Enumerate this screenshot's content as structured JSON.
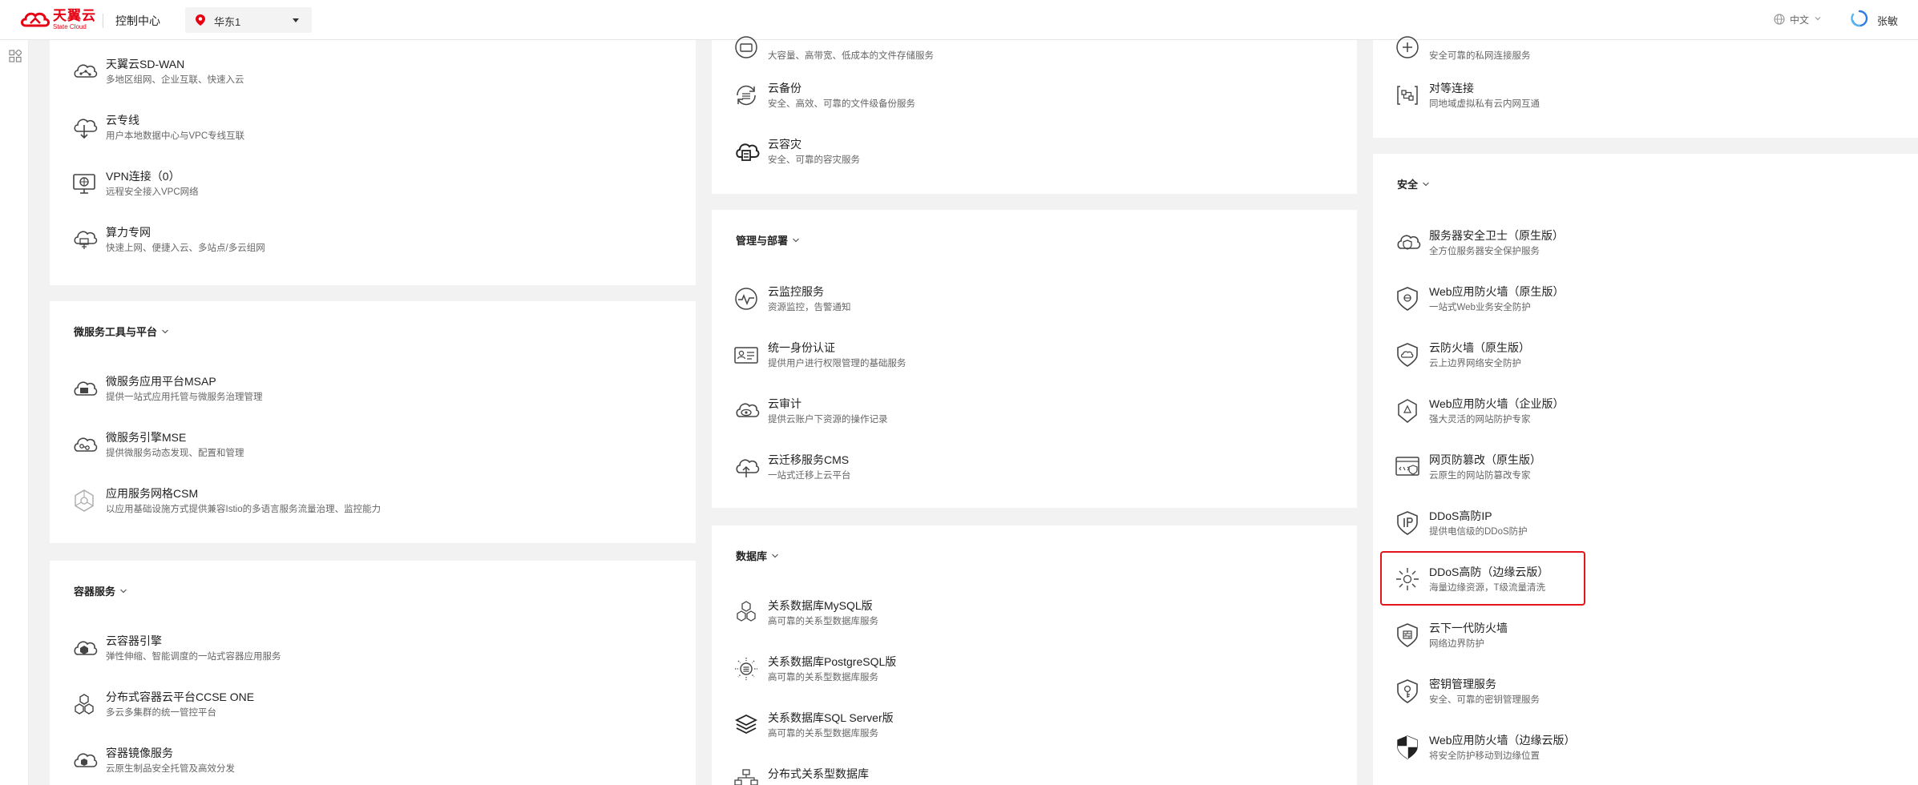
{
  "header": {
    "logo_text": "天翼云",
    "logo_sub": "State Cloud",
    "console_title": "控制中心",
    "region": "华东1",
    "lang": "中文",
    "user": "张敏"
  },
  "colors": {
    "brand": "#e60012",
    "highlight": "#e3161b"
  },
  "col_a": {
    "network_items": [
      {
        "name": "天翼云SD-WAN",
        "desc": "多地区组网、企业互联、快速入云",
        "icon": "sdwan-icon"
      },
      {
        "name": "云专线",
        "desc": "用户本地数据中心与VPC专线互联",
        "icon": "dedicated-line-icon"
      },
      {
        "name": "VPN连接（0）",
        "desc": "远程安全接入VPC网络",
        "icon": "vpn-icon"
      },
      {
        "name": "算力专网",
        "desc": "快速上网、便捷入云、多站点/多云组网",
        "icon": "computing-network-icon"
      }
    ],
    "micro_title": "微服务工具与平台",
    "micro_items": [
      {
        "name": "微服务应用平台MSAP",
        "desc": "提供一站式应用托管与微服务治理管理",
        "icon": "msap-icon"
      },
      {
        "name": "微服务引擎MSE",
        "desc": "提供微服务动态发现、配置和管理",
        "icon": "mse-icon"
      },
      {
        "name": "应用服务网格CSM",
        "desc": "以应用基础设施方式提供兼容Istio的多语言服务流量治理、监控能力",
        "icon": "csm-icon"
      }
    ],
    "container_title": "容器服务",
    "container_items": [
      {
        "name": "云容器引擎",
        "desc": "弹性伸缩、智能调度的一站式容器应用服务",
        "icon": "container-engine-icon"
      },
      {
        "name": "分布式容器云平台CCSE ONE",
        "desc": "多云多集群的统一管控平台",
        "icon": "ccse-one-icon"
      },
      {
        "name": "容器镜像服务",
        "desc": "云原生制品安全托管及高效分发",
        "icon": "image-registry-icon"
      }
    ]
  },
  "col_b": {
    "storage_items": [
      {
        "name": "",
        "desc": "大容量、高带宽、低成本的文件存储服务",
        "icon": "file-storage-icon"
      },
      {
        "name": "云备份",
        "desc": "安全、高效、可靠的文件级备份服务",
        "icon": "backup-icon"
      },
      {
        "name": "云容灾",
        "desc": "安全、可靠的容灾服务",
        "icon": "disaster-recovery-icon"
      }
    ],
    "mgmt_title": "管理与部署",
    "mgmt_items": [
      {
        "name": "云监控服务",
        "desc": "资源监控，告警通知",
        "icon": "monitor-icon"
      },
      {
        "name": "统一身份认证",
        "desc": "提供用户进行权限管理的基础服务",
        "icon": "iam-icon"
      },
      {
        "name": "云审计",
        "desc": "提供云账户下资源的操作记录",
        "icon": "audit-icon"
      },
      {
        "name": "云迁移服务CMS",
        "desc": "一站式迁移上云平台",
        "icon": "migration-icon"
      }
    ],
    "db_title": "数据库",
    "db_items": [
      {
        "name": "关系数据库MySQL版",
        "desc": "高可靠的关系型数据库服务",
        "icon": "mysql-icon"
      },
      {
        "name": "关系数据库PostgreSQL版",
        "desc": "高可靠的关系型数据库服务",
        "icon": "postgresql-icon"
      },
      {
        "name": "关系数据库SQL Server版",
        "desc": "高可靠的关系型数据库服务",
        "icon": "sqlserver-icon"
      },
      {
        "name": "分布式关系型数据库",
        "desc": "",
        "icon": "distributed-db-icon"
      }
    ]
  },
  "col_c": {
    "net_items": [
      {
        "name": "",
        "desc": "安全可靠的私网连接服务",
        "icon": "private-link-icon"
      },
      {
        "name": "对等连接",
        "desc": "同地域虚拟私有云内网互通",
        "icon": "peering-icon"
      }
    ],
    "security_title": "安全",
    "security_items": [
      {
        "name": "服务器安全卫士（原生版）",
        "desc": "全方位服务器安全保护服务",
        "icon": "server-guard-icon"
      },
      {
        "name": "Web应用防火墙（原生版）",
        "desc": "一站式Web业务安全防护",
        "icon": "waf-native-icon"
      },
      {
        "name": "云防火墙（原生版）",
        "desc": "云上边界网络安全防护",
        "icon": "cloud-firewall-icon"
      },
      {
        "name": "Web应用防火墙（企业版）",
        "desc": "强大灵活的网站防护专家",
        "icon": "waf-enterprise-icon"
      },
      {
        "name": "网页防篡改（原生版）",
        "desc": "云原生的网站防篡改专家",
        "icon": "anti-tamper-icon"
      },
      {
        "name": "DDoS高防IP",
        "desc": "提供电信级的DDoS防护",
        "icon": "ddos-ip-icon"
      },
      {
        "name": "DDoS高防（边缘云版）",
        "desc": "海量边缘资源，T级流量清洗",
        "icon": "ddos-edge-icon"
      },
      {
        "name": "云下一代防火墙",
        "desc": "网络边界防护",
        "icon": "ngfw-icon"
      },
      {
        "name": "密钥管理服务",
        "desc": "安全、可靠的密钥管理服务",
        "icon": "kms-icon"
      },
      {
        "name": "Web应用防火墙（边缘云版）",
        "desc": "将安全防护移动到边缘位置",
        "icon": "waf-edge-icon"
      }
    ]
  }
}
